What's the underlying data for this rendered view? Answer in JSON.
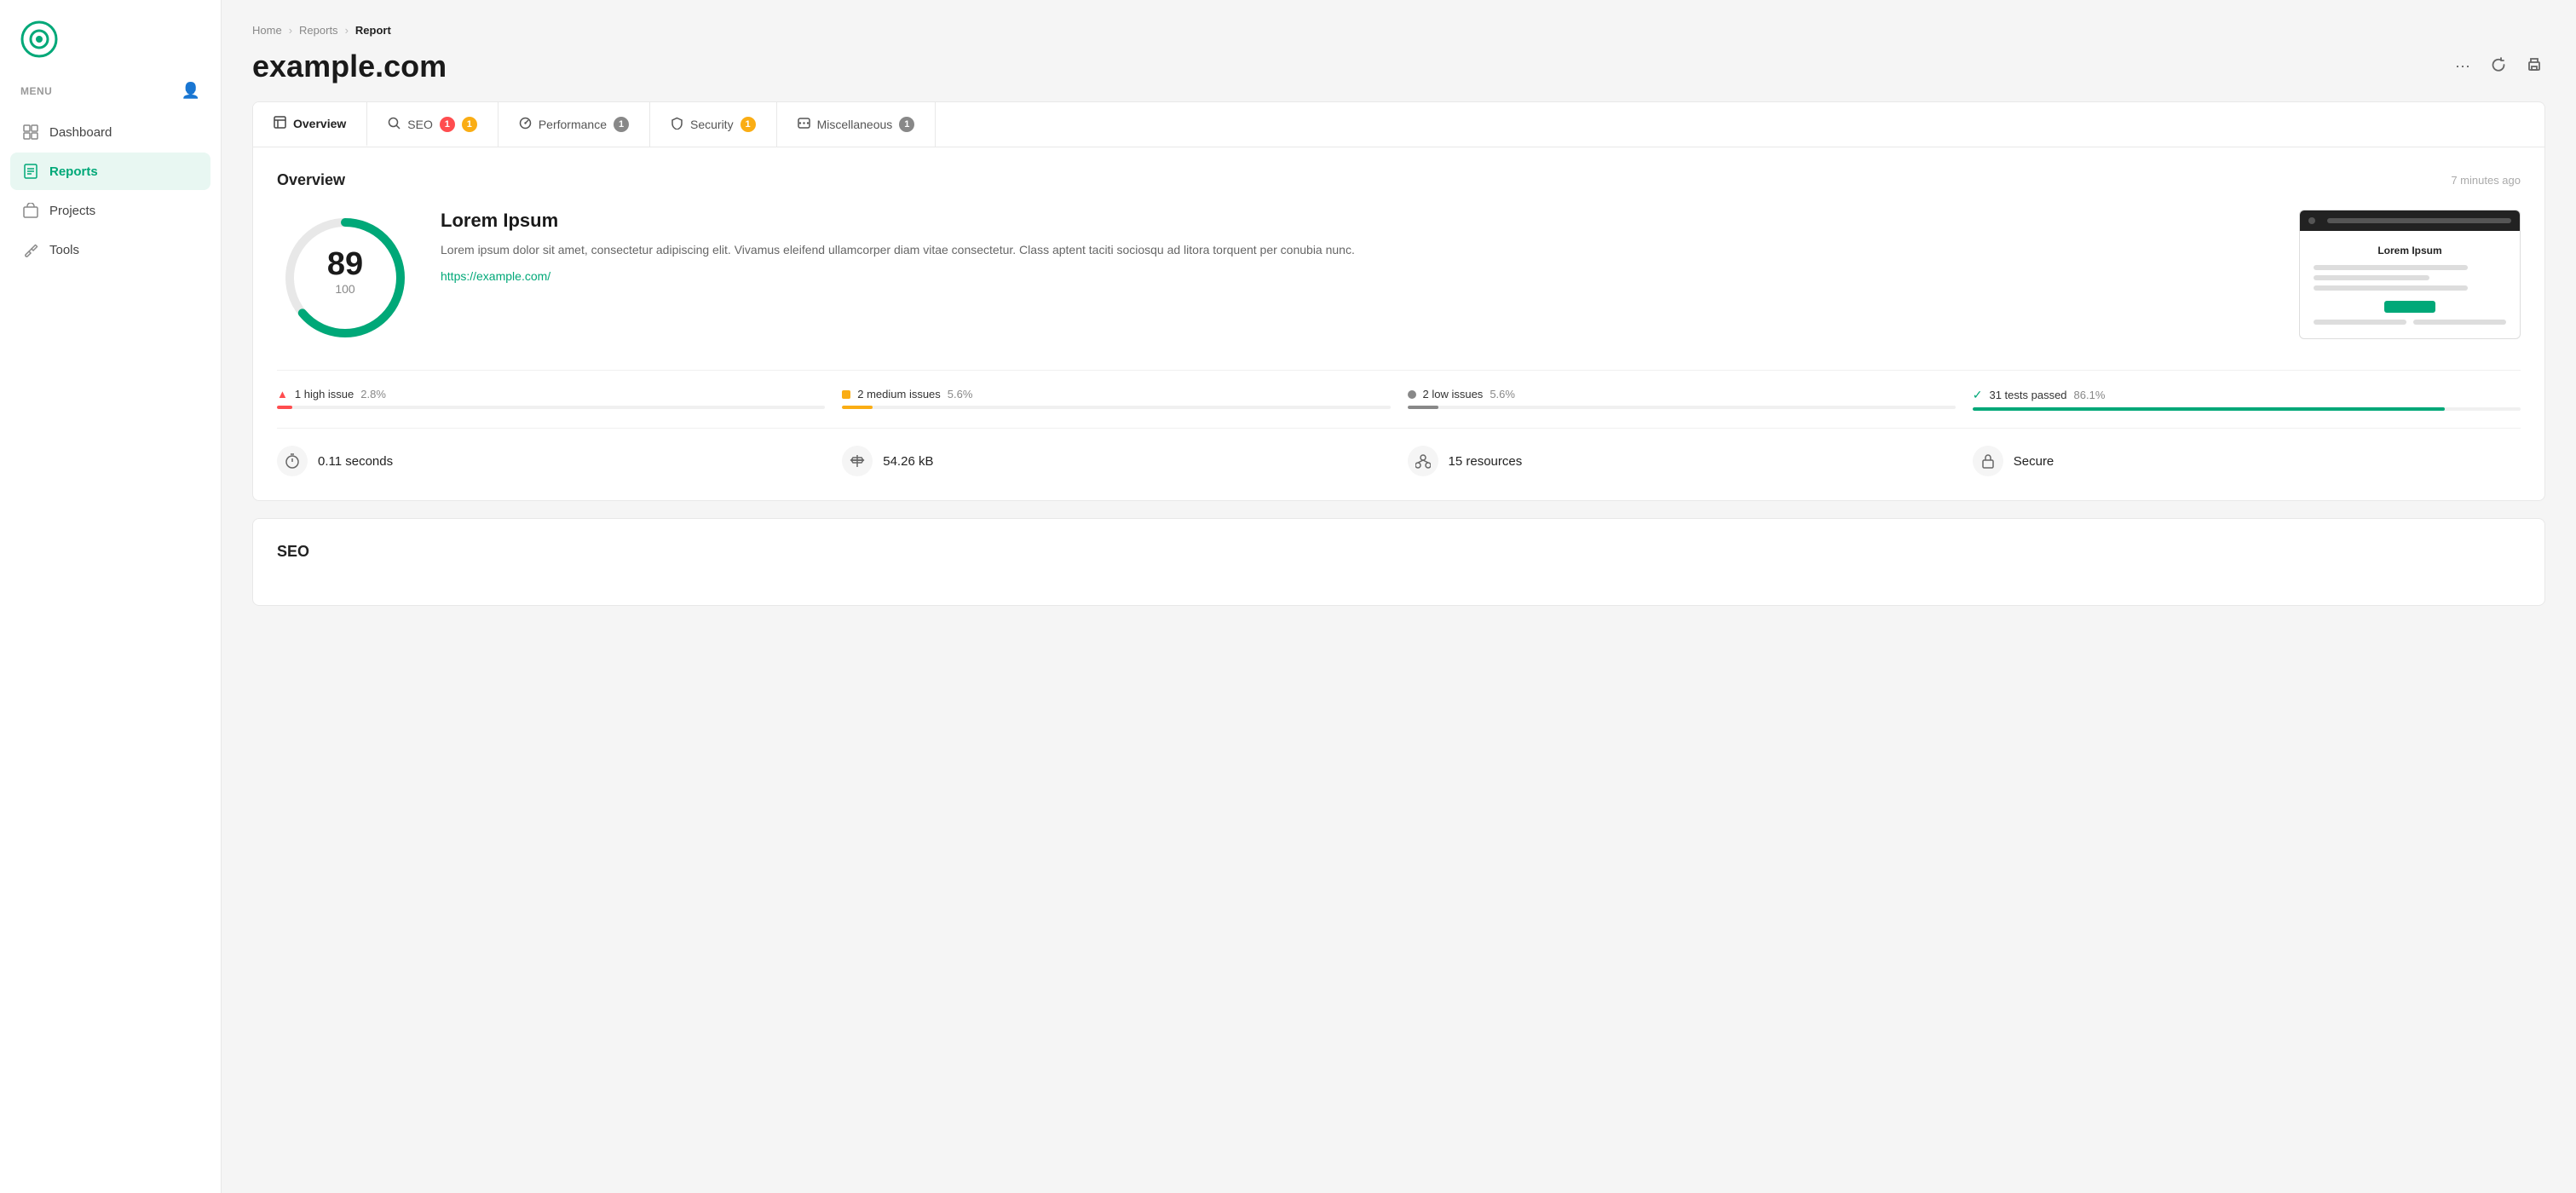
{
  "sidebar": {
    "menu_label": "MENU",
    "items": [
      {
        "id": "dashboard",
        "label": "Dashboard",
        "active": false
      },
      {
        "id": "reports",
        "label": "Reports",
        "active": true
      },
      {
        "id": "projects",
        "label": "Projects",
        "active": false
      },
      {
        "id": "tools",
        "label": "Tools",
        "active": false
      }
    ]
  },
  "breadcrumb": {
    "home": "Home",
    "reports": "Reports",
    "current": "Report"
  },
  "page": {
    "title": "example.com"
  },
  "tabs": [
    {
      "id": "overview",
      "label": "Overview",
      "badge": null,
      "badge_type": null,
      "active": true
    },
    {
      "id": "seo",
      "label": "SEO",
      "badge": "1",
      "badge2": "1",
      "badge_type": "mixed",
      "active": false
    },
    {
      "id": "performance",
      "label": "Performance",
      "badge": "1",
      "badge_type": "gray",
      "active": false
    },
    {
      "id": "security",
      "label": "Security",
      "badge": "1",
      "badge_type": "yellow",
      "active": false
    },
    {
      "id": "miscellaneous",
      "label": "Miscellaneous",
      "badge": "1",
      "badge_type": "gray",
      "active": false
    }
  ],
  "overview": {
    "section_title": "Overview",
    "time_ago": "7 minutes ago",
    "score": {
      "value": 89,
      "max": 100,
      "percentage": 89
    },
    "site_title": "Lorem Ipsum",
    "description": "Lorem ipsum dolor sit amet, consectetur adipiscing elit. Vivamus eleifend ullamcorper diam vitae consectetur. Class aptent taciti sociosqu ad litora torquent per conubia nunc.",
    "url": "https://example.com/",
    "preview_title": "Lorem Ipsum",
    "issues": [
      {
        "label": "1 high issue",
        "pct": "2.8%",
        "pct_num": 2.8,
        "type": "high"
      },
      {
        "label": "2 medium issues",
        "pct": "5.6%",
        "pct_num": 5.6,
        "type": "medium"
      },
      {
        "label": "2 low issues",
        "pct": "5.6%",
        "pct_num": 5.6,
        "type": "low"
      },
      {
        "label": "31 tests passed",
        "pct": "86.1%",
        "pct_num": 86.1,
        "type": "passed"
      }
    ],
    "stats": [
      {
        "icon": "timer",
        "value": "0.11 seconds"
      },
      {
        "icon": "scale",
        "value": "54.26 kB"
      },
      {
        "icon": "resources",
        "value": "15 resources"
      },
      {
        "icon": "lock",
        "value": "Secure"
      }
    ]
  },
  "seo_section": {
    "title": "SEO"
  },
  "colors": {
    "brand": "#00a878",
    "red": "#ff4d4f",
    "yellow": "#faad14",
    "gray": "#888888"
  }
}
